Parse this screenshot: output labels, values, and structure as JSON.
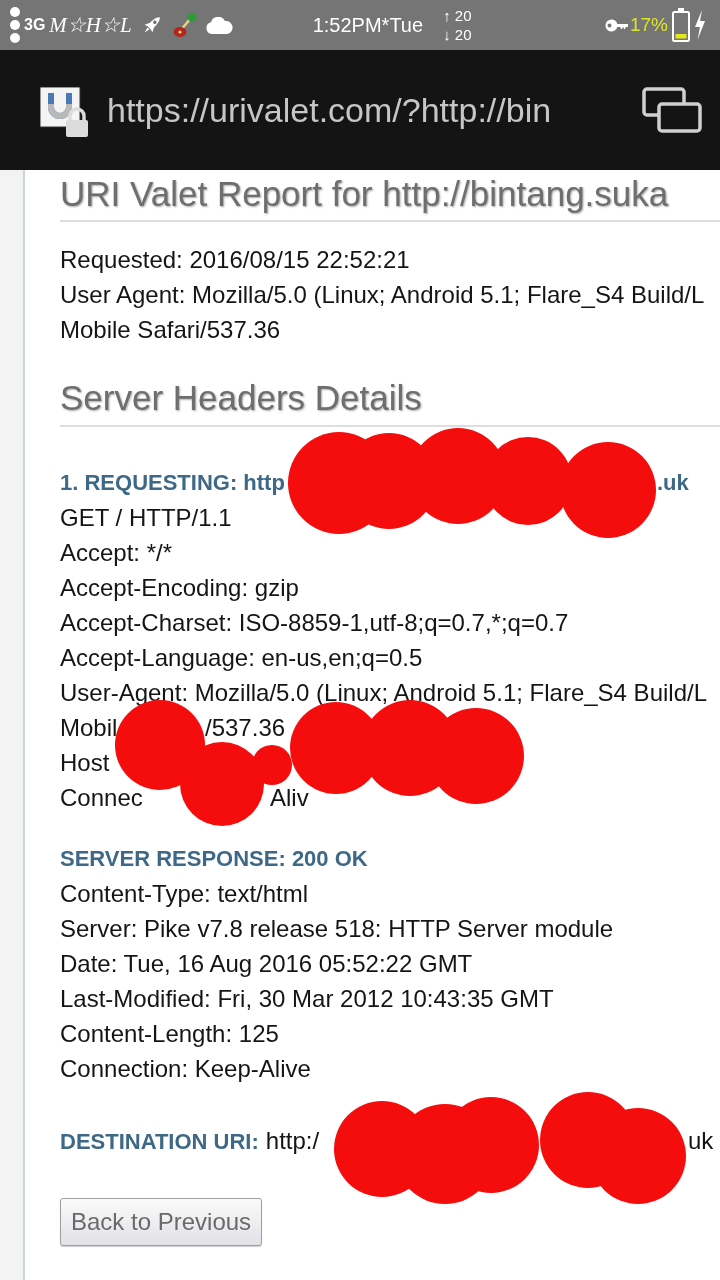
{
  "status_bar": {
    "network": "3G",
    "carrier": "M☆H☆L",
    "time": "1:52PM*Tue",
    "upload": "↑ 20",
    "download": "↓ 20",
    "battery": "17%"
  },
  "address_bar": {
    "url": "https://urivalet.com/?http://bin"
  },
  "report": {
    "title": "URI Valet Report for http://bintang.suka",
    "info": [
      "Requested: 2016/08/15 22:52:21",
      "User Agent: Mozilla/5.0 (Linux; Android 5.1; Flare_S4 Build/L",
      "Mobile Safari/537.36"
    ]
  },
  "server_headers": {
    "title": "Server Headers Details",
    "request": {
      "heading": [
        "1. REQUESTING: http",
        ".uk"
      ],
      "lines": [
        {
          "parts": [
            "GET / HTTP/1.1"
          ]
        },
        {
          "parts": [
            "Accept: */*"
          ]
        },
        {
          "parts": [
            "Accept-Encoding: gzip"
          ]
        },
        {
          "parts": [
            "Accept-Charset: ISO-8859-1,utf-8;q=0.7,*;q=0.7"
          ]
        },
        {
          "parts": [
            "Accept-Language: en-us,en;q=0.5"
          ]
        },
        {
          "parts": [
            "User-Agent: Mozilla/5.0 (Linux; Android 5.1; Flare_S4 Build/L"
          ]
        },
        {
          "parts": [
            "Mobil",
            "/537.36"
          ]
        },
        {
          "parts": [
            "Host"
          ]
        },
        {
          "parts": [
            "Connec",
            "Aliv"
          ]
        }
      ]
    },
    "response": {
      "heading": "SERVER RESPONSE: 200 OK",
      "lines": [
        "Content-Type: text/html",
        "Server: Pike v7.8 release 518: HTTP Server module",
        "Date: Tue, 16 Aug 2016 05:52:22 GMT",
        "Last-Modified: Fri, 30 Mar 2012 10:43:35 GMT",
        "Content-Length: 125",
        "Connection: Keep-Alive"
      ]
    },
    "destination": {
      "label": "DESTINATION URI:",
      "value": [
        "http:/",
        "uk"
      ]
    }
  },
  "back_button": {
    "label": "Back to Previous"
  }
}
